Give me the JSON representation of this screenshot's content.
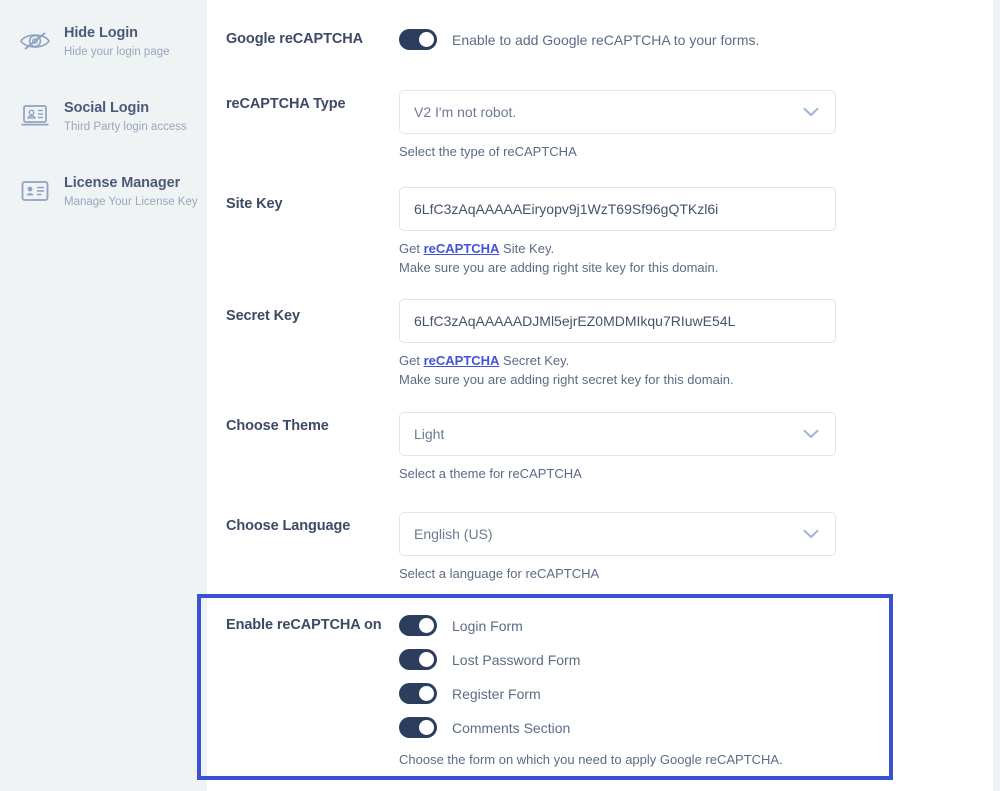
{
  "sidebar": {
    "items": [
      {
        "icon": "eye-slash-icon",
        "title": "Hide Login",
        "subtitle": "Hide your login page"
      },
      {
        "icon": "social-login-icon",
        "title": "Social Login",
        "subtitle": "Third Party login access"
      },
      {
        "icon": "license-card-icon",
        "title": "License Manager",
        "subtitle": "Manage Your License Key"
      }
    ]
  },
  "form": {
    "google_recaptcha": {
      "label": "Google reCAPTCHA",
      "toggle_on": true,
      "description": "Enable to add Google reCAPTCHA to your forms."
    },
    "recaptcha_type": {
      "label": "reCAPTCHA Type",
      "value": "V2 I'm not robot.",
      "helper": "Select the type of reCAPTCHA"
    },
    "site_key": {
      "label": "Site Key",
      "value": "6LfC3zAqAAAAAEiryopv9j1WzT69Sf96gQTKzl6i",
      "helper_prefix": "Get ",
      "helper_link": "reCAPTCHA",
      "helper_suffix": " Site Key.",
      "helper_line2": "Make sure you are adding right site key for this domain."
    },
    "secret_key": {
      "label": "Secret Key",
      "value": "6LfC3zAqAAAAADJMl5ejrEZ0MDMIkqu7RIuwE54L",
      "helper_prefix": "Get ",
      "helper_link": "reCAPTCHA",
      "helper_suffix": " Secret Key.",
      "helper_line2": "Make sure you are adding right secret key for this domain."
    },
    "choose_theme": {
      "label": "Choose Theme",
      "value": "Light",
      "helper": "Select a theme for reCAPTCHA"
    },
    "choose_language": {
      "label": "Choose Language",
      "value": "English (US)",
      "helper": "Select a language for reCAPTCHA"
    },
    "enable_on": {
      "label": "Enable reCAPTCHA on",
      "options": [
        {
          "label": "Login Form",
          "toggle_on": true
        },
        {
          "label": "Lost Password Form",
          "toggle_on": true
        },
        {
          "label": "Register Form",
          "toggle_on": true
        },
        {
          "label": "Comments Section",
          "toggle_on": true
        }
      ],
      "helper": "Choose the form on which you need to apply Google reCAPTCHA."
    }
  },
  "colors": {
    "highlight_border": "#3b51d4",
    "toggle_on": "#2c3e5d",
    "link": "#4153d8",
    "label": "#3d4a66",
    "sidebar_bg": "#eff3f4"
  }
}
